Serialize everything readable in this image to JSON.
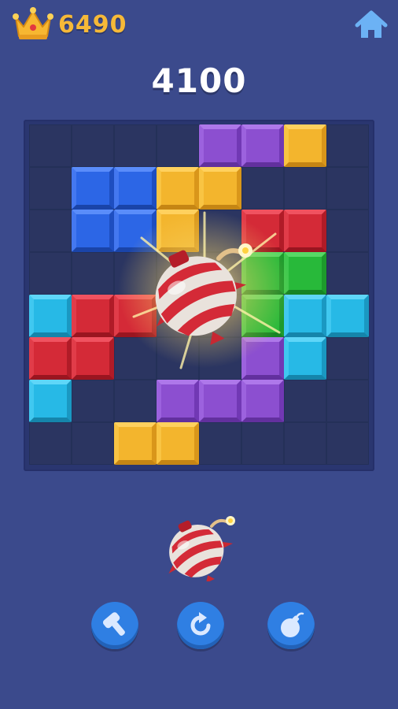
{
  "header": {
    "best_score": "6490",
    "crown_icon": "crown-icon",
    "home_icon": "home-icon"
  },
  "score": "4100",
  "board": {
    "rows": 8,
    "cols": 8,
    "blocks": [
      {
        "row": 0,
        "col": 4,
        "color": "purple"
      },
      {
        "row": 0,
        "col": 5,
        "color": "purple"
      },
      {
        "row": 0,
        "col": 6,
        "color": "yellow"
      },
      {
        "row": 1,
        "col": 1,
        "color": "blue"
      },
      {
        "row": 1,
        "col": 2,
        "color": "blue"
      },
      {
        "row": 1,
        "col": 3,
        "color": "yellow"
      },
      {
        "row": 1,
        "col": 4,
        "color": "yellow"
      },
      {
        "row": 2,
        "col": 1,
        "color": "blue"
      },
      {
        "row": 2,
        "col": 2,
        "color": "blue"
      },
      {
        "row": 2,
        "col": 3,
        "color": "yellow"
      },
      {
        "row": 2,
        "col": 5,
        "color": "red"
      },
      {
        "row": 2,
        "col": 6,
        "color": "red"
      },
      {
        "row": 3,
        "col": 5,
        "color": "green"
      },
      {
        "row": 3,
        "col": 6,
        "color": "green"
      },
      {
        "row": 4,
        "col": 0,
        "color": "cyan"
      },
      {
        "row": 4,
        "col": 1,
        "color": "red"
      },
      {
        "row": 4,
        "col": 2,
        "color": "red"
      },
      {
        "row": 4,
        "col": 5,
        "color": "green"
      },
      {
        "row": 4,
        "col": 6,
        "color": "cyan"
      },
      {
        "row": 4,
        "col": 7,
        "color": "cyan"
      },
      {
        "row": 5,
        "col": 0,
        "color": "red"
      },
      {
        "row": 5,
        "col": 1,
        "color": "red"
      },
      {
        "row": 5,
        "col": 5,
        "color": "purple"
      },
      {
        "row": 5,
        "col": 6,
        "color": "cyan"
      },
      {
        "row": 6,
        "col": 0,
        "color": "cyan"
      },
      {
        "row": 6,
        "col": 3,
        "color": "purple"
      },
      {
        "row": 6,
        "col": 4,
        "color": "purple"
      },
      {
        "row": 6,
        "col": 5,
        "color": "purple"
      },
      {
        "row": 7,
        "col": 2,
        "color": "yellow"
      },
      {
        "row": 7,
        "col": 3,
        "color": "yellow"
      }
    ]
  },
  "piece_tray": {
    "piece": "bomb-icon"
  },
  "tools": [
    {
      "name": "hammer-tool-button",
      "icon": "hammer-icon"
    },
    {
      "name": "refresh-tool-button",
      "icon": "refresh-icon"
    },
    {
      "name": "bomb-tool-button",
      "icon": "bomb-icon"
    }
  ],
  "colors": {
    "background": "#3b4a8c",
    "best_score": "#f6b938",
    "blue": "#2c66e6",
    "yellow": "#f3b52d",
    "purple": "#8c4fd0",
    "red": "#d42a37",
    "green": "#28b93a",
    "cyan": "#27b9e6",
    "tool_button": "#2f7fe3"
  }
}
